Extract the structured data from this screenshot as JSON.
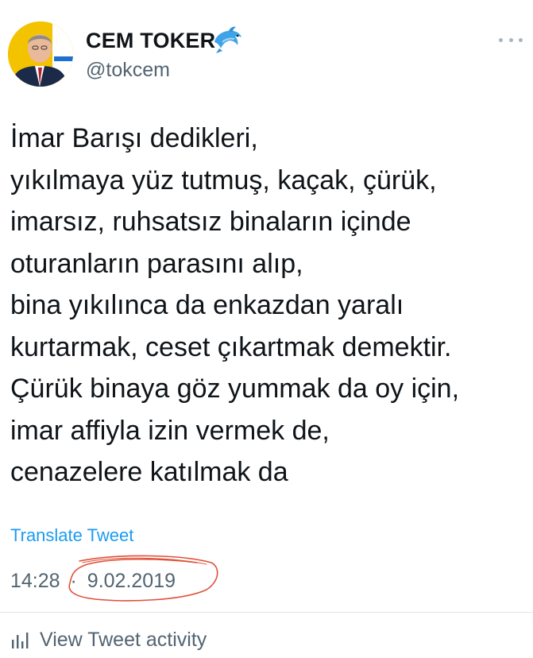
{
  "author": {
    "display_name": "CEM TOKER",
    "handle": "@tokcem",
    "badge_icon": "dolphin-icon"
  },
  "tweet": {
    "lines": [
      "İmar Barışı dedikleri,",
      "yıkılmaya yüz tutmuş, kaçak, çürük,",
      "imarsız, ruhsatsız binaların içinde",
      "oturanların parasını alıp,",
      "bina yıkılınca da enkazdan yaralı",
      "kurtarmak, ceset çıkartmak demektir.",
      "Çürük binaya göz yummak da oy için,",
      "imar affiyla izin vermek de,",
      "cenazelere katılmak da"
    ],
    "translate_label": "Translate Tweet",
    "time": "14:28",
    "separator": "·",
    "date": "9.02.2019"
  },
  "actions": {
    "activity_label": "View Tweet activity"
  },
  "colors": {
    "link": "#1d9bf0",
    "secondary_text": "#536471",
    "annotation_circle": "#e0503a"
  }
}
